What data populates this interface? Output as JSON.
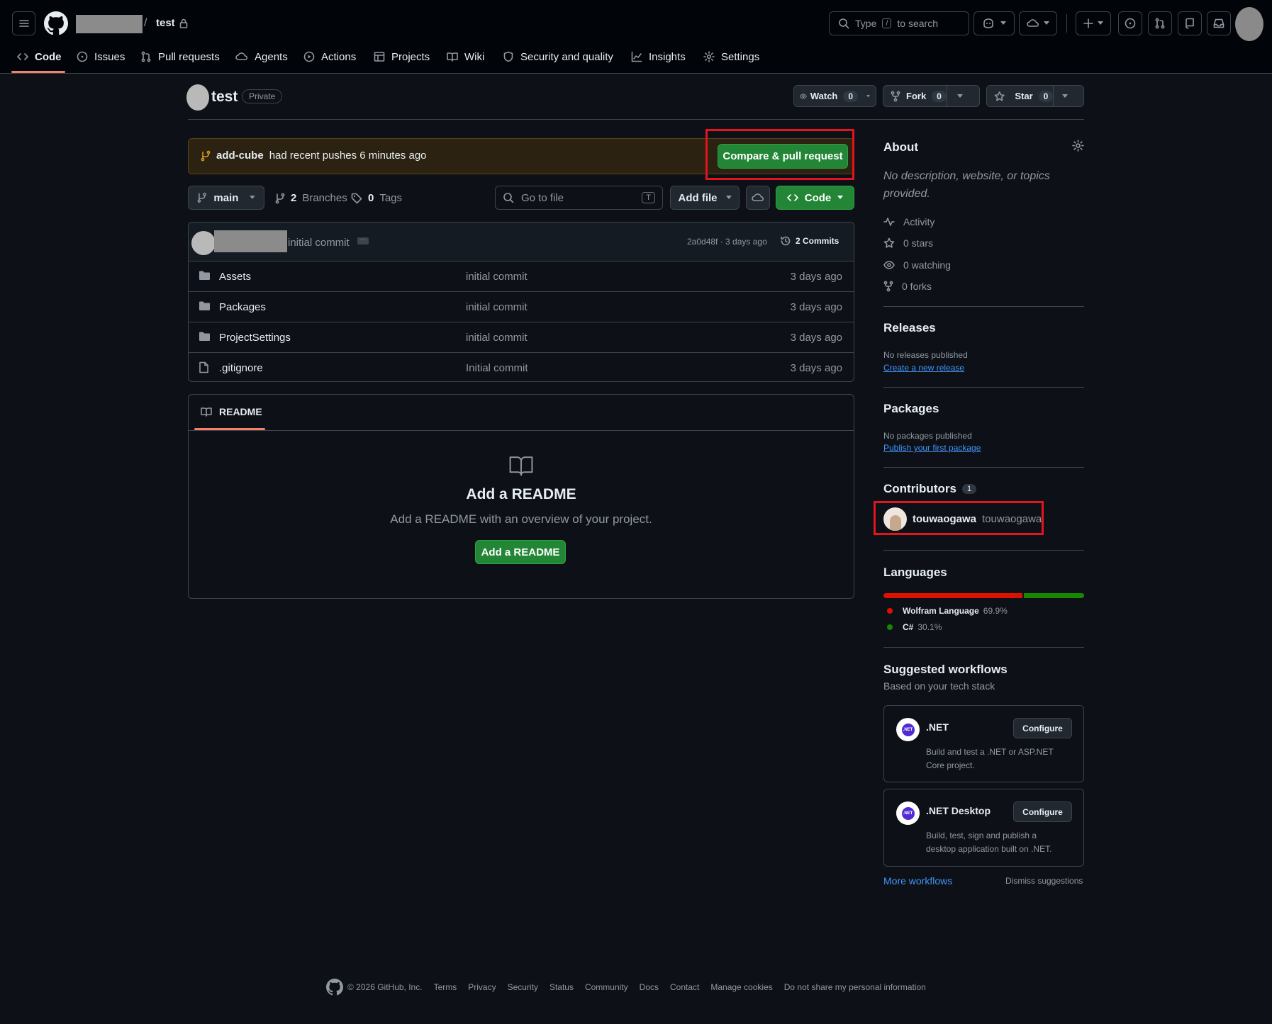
{
  "header": {
    "owner_name": "",
    "separator": "/",
    "repo_name": "test",
    "search_prefix": "Type",
    "search_key": "/",
    "search_suffix": "to search"
  },
  "tabs": [
    {
      "label": "Code"
    },
    {
      "label": "Issues"
    },
    {
      "label": "Pull requests"
    },
    {
      "label": "Agents"
    },
    {
      "label": "Actions"
    },
    {
      "label": "Projects"
    },
    {
      "label": "Wiki"
    },
    {
      "label": "Security and quality"
    },
    {
      "label": "Insights"
    },
    {
      "label": "Settings"
    }
  ],
  "repo": {
    "title": "test",
    "visibility": "Private",
    "watch_label": "Watch",
    "watch_count": "0",
    "fork_label": "Fork",
    "fork_count": "0",
    "star_label": "Star",
    "star_count": "0"
  },
  "banner": {
    "branch": "add-cube",
    "text": "had recent pushes 6 minutes ago",
    "button": "Compare & pull request"
  },
  "toolbar": {
    "branch": "main",
    "branches_count": "2",
    "branches_label": "Branches",
    "tags_count": "0",
    "tags_label": "Tags",
    "goto_placeholder": "Go to file",
    "goto_key": "T",
    "add_file": "Add file",
    "code": "Code"
  },
  "commit": {
    "message": "initial commit",
    "hash_time": "2a0d48f · 3 days ago",
    "commits_label": "2 Commits"
  },
  "files": [
    {
      "name": "Assets",
      "message": "initial commit",
      "age": "3 days ago",
      "type": "folder"
    },
    {
      "name": "Packages",
      "message": "initial commit",
      "age": "3 days ago",
      "type": "folder"
    },
    {
      "name": "ProjectSettings",
      "message": "initial commit",
      "age": "3 days ago",
      "type": "folder"
    },
    {
      "name": ".gitignore",
      "message": "Initial commit",
      "age": "3 days ago",
      "type": "file"
    }
  ],
  "readme": {
    "tab": "README",
    "title": "Add a README",
    "subtitle": "Add a README with an overview of your project.",
    "button": "Add a README"
  },
  "about": {
    "title": "About",
    "description": "No description, website, or topics provided.",
    "activity": "Activity",
    "stars": "0 stars",
    "watching": "0 watching",
    "forks": "0 forks"
  },
  "releases": {
    "title": "Releases",
    "empty": "No releases published",
    "link": "Create a new release"
  },
  "packages": {
    "title": "Packages",
    "empty": "No packages published",
    "link": "Publish your first package"
  },
  "contributors": {
    "title": "Contributors",
    "count": "1",
    "login": "touwaogawa",
    "name": "touwaogawa"
  },
  "languages": {
    "title": "Languages",
    "items": [
      {
        "name": "Wolfram Language",
        "percent": "69.9%",
        "value": 69.9,
        "color": "#dd1100"
      },
      {
        "name": "C#",
        "percent": "30.1%",
        "value": 30.1,
        "color": "#178600"
      }
    ]
  },
  "workflows": {
    "title": "Suggested workflows",
    "subtitle": "Based on your tech stack",
    "items": [
      {
        "name": ".NET",
        "desc_line1": "Build and test a .NET or ASP.NET",
        "desc_line2": "Core project.",
        "button": "Configure",
        "logo": ".NET"
      },
      {
        "name": ".NET Desktop",
        "desc_line1": "Build, test, sign and publish a",
        "desc_line2": "desktop application built on .NET.",
        "button": "Configure",
        "logo": ".NET"
      }
    ],
    "more": "More workflows",
    "dismiss": "Dismiss suggestions"
  },
  "footer": {
    "copyright": "© 2026 GitHub, Inc.",
    "links": [
      "Terms",
      "Privacy",
      "Security",
      "Status",
      "Community",
      "Docs",
      "Contact",
      "Manage cookies",
      "Do not share my personal information"
    ]
  },
  "colors": {
    "accent_green": "#238636",
    "highlight_red": "#e5131d",
    "link_blue": "#4493f8",
    "tab_underline": "#f78166"
  }
}
